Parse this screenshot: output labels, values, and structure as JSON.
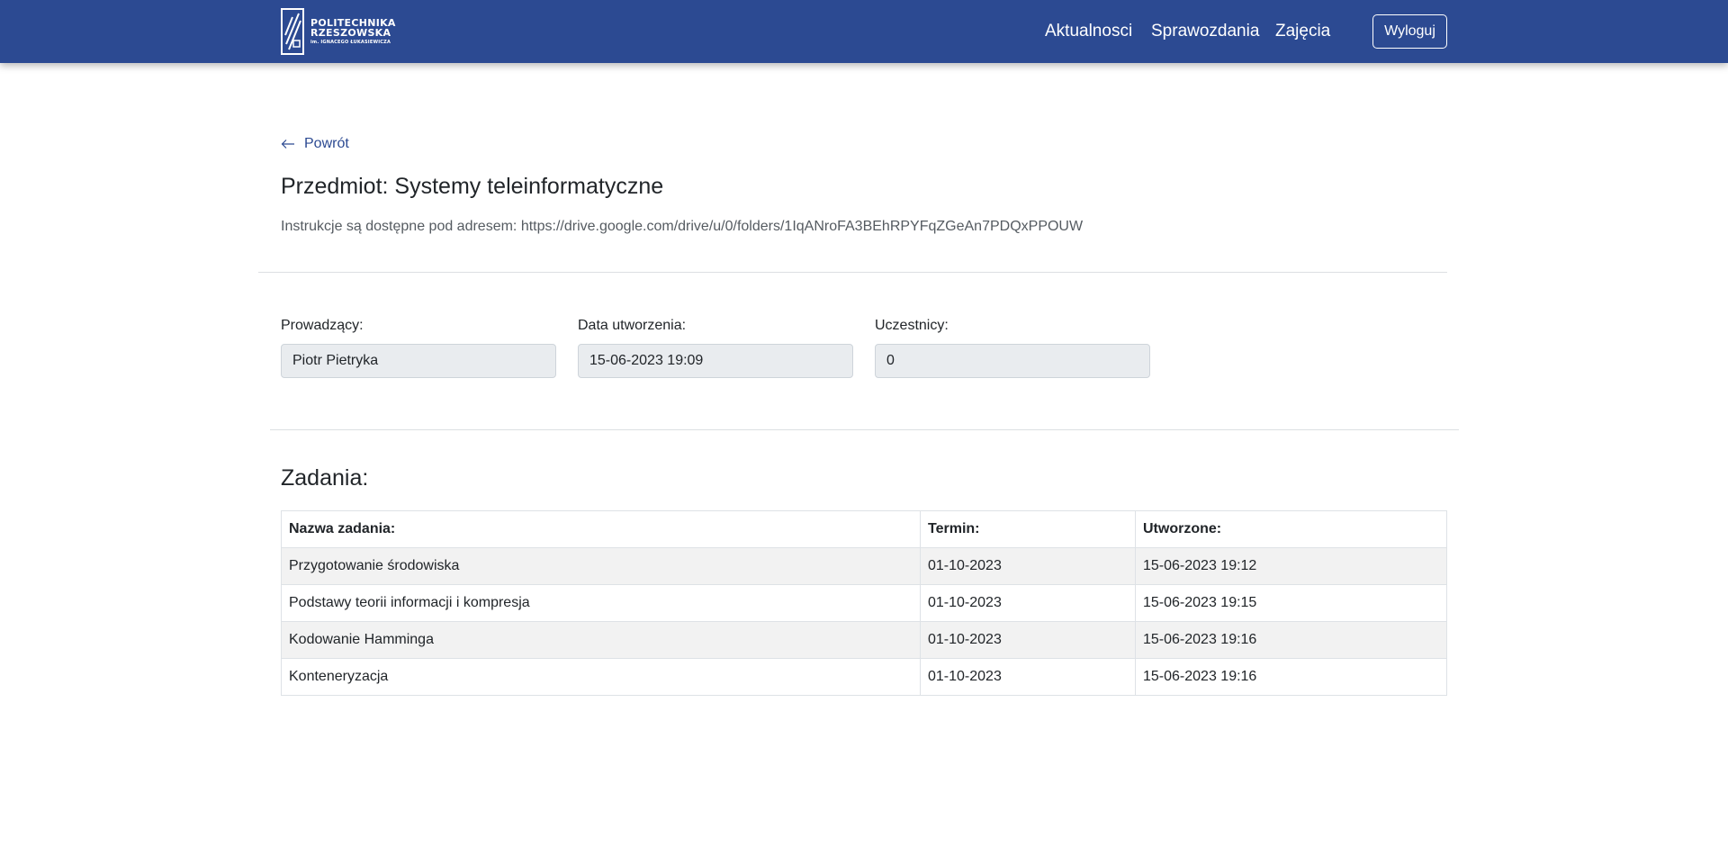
{
  "header": {
    "brand_line1": "POLITECHNIKA",
    "brand_line2": "RZESZOWSKA",
    "brand_line3": "im. IGNACEGO ŁUKASIEWICZA",
    "nav": [
      "Aktualnosci",
      "Sprawozdania",
      "Zajęcia"
    ],
    "logout_label": "Wyloguj"
  },
  "page": {
    "back_label": "Powrót",
    "subject_title": "Przedmiot: Systemy teleinformatyczne",
    "instructions": "Instrukcje są dostępne pod adresem: https://drive.google.com/drive/u/0/folders/1IqANroFA3BEhRPYFqZGeAn7PDQxPPOUW"
  },
  "fields": {
    "teacher": {
      "label": "Prowadzący:",
      "value": "Piotr Pietryka"
    },
    "created": {
      "label": "Data utworzenia:",
      "value": "15-06-2023 19:09"
    },
    "participants": {
      "label": "Uczestnicy:",
      "value": "0"
    }
  },
  "tasks": {
    "heading": "Zadania:",
    "columns": [
      "Nazwa zadania:",
      "Termin:",
      "Utworzone:"
    ],
    "rows": [
      [
        "Przygotowanie środowiska",
        "01-10-2023",
        "15-06-2023 19:12"
      ],
      [
        "Podstawy teorii informacji i kompresja",
        "01-10-2023",
        "15-06-2023 19:15"
      ],
      [
        "Kodowanie Hamminga",
        "01-10-2023",
        "15-06-2023 19:16"
      ],
      [
        "Konteneryzacja",
        "01-10-2023",
        "15-06-2023 19:16"
      ]
    ]
  },
  "colors": {
    "navbar": "#2c4a92",
    "accent": "#2c4a92",
    "input_bg": "#e9ecef",
    "row_stripe": "#f2f2f2"
  },
  "icons": {
    "logo": "university-logo-icon",
    "back": "arrow-left-icon"
  }
}
